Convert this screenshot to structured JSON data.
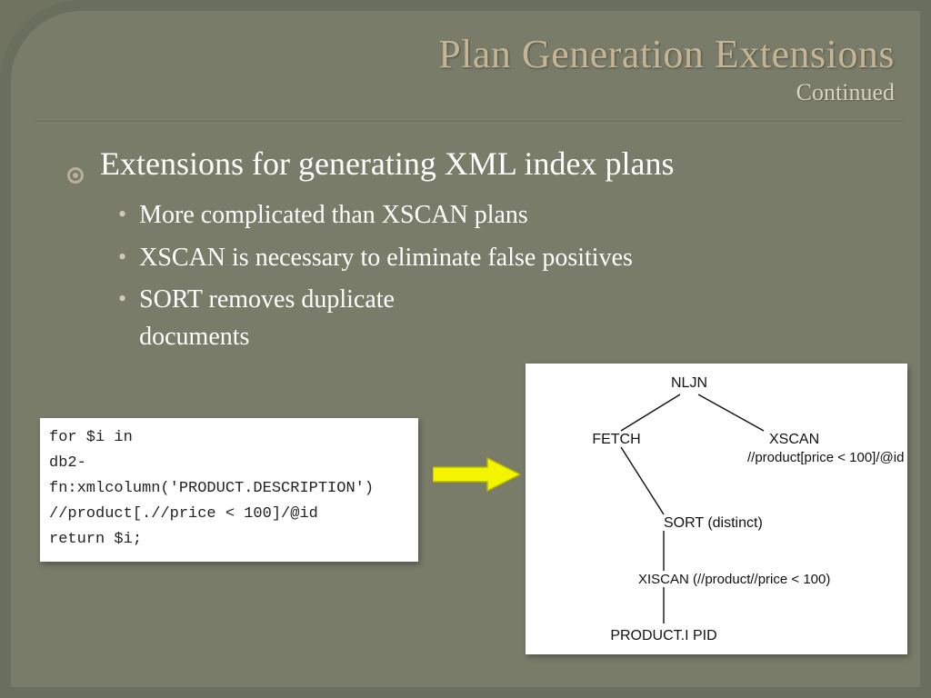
{
  "header": {
    "title": "Plan Generation Extensions",
    "subtitle": "Continued"
  },
  "content": {
    "main_bullet": "Extensions for generating XML index plans",
    "sub_bullets": [
      "More complicated than XSCAN plans",
      "XSCAN is necessary to eliminate false positives",
      "SORT removes duplicate documents"
    ]
  },
  "code": {
    "line1": "for $i in",
    "line2": "db2-fn:xmlcolumn('PRODUCT.DESCRIPTION')",
    "line3": "//product[.//price < 100]/@id",
    "line4": "return $i;"
  },
  "tree": {
    "root": "NLJN",
    "fetch": "FETCH",
    "xscan": "XSCAN",
    "xscan_expr": "//product[price < 100]/@id",
    "sort": "SORT (distinct)",
    "xiscan": "XISCAN (//product//price < 100)",
    "leaf": "PRODUCT.I PID"
  },
  "icons": {
    "arrow": "right-arrow"
  }
}
